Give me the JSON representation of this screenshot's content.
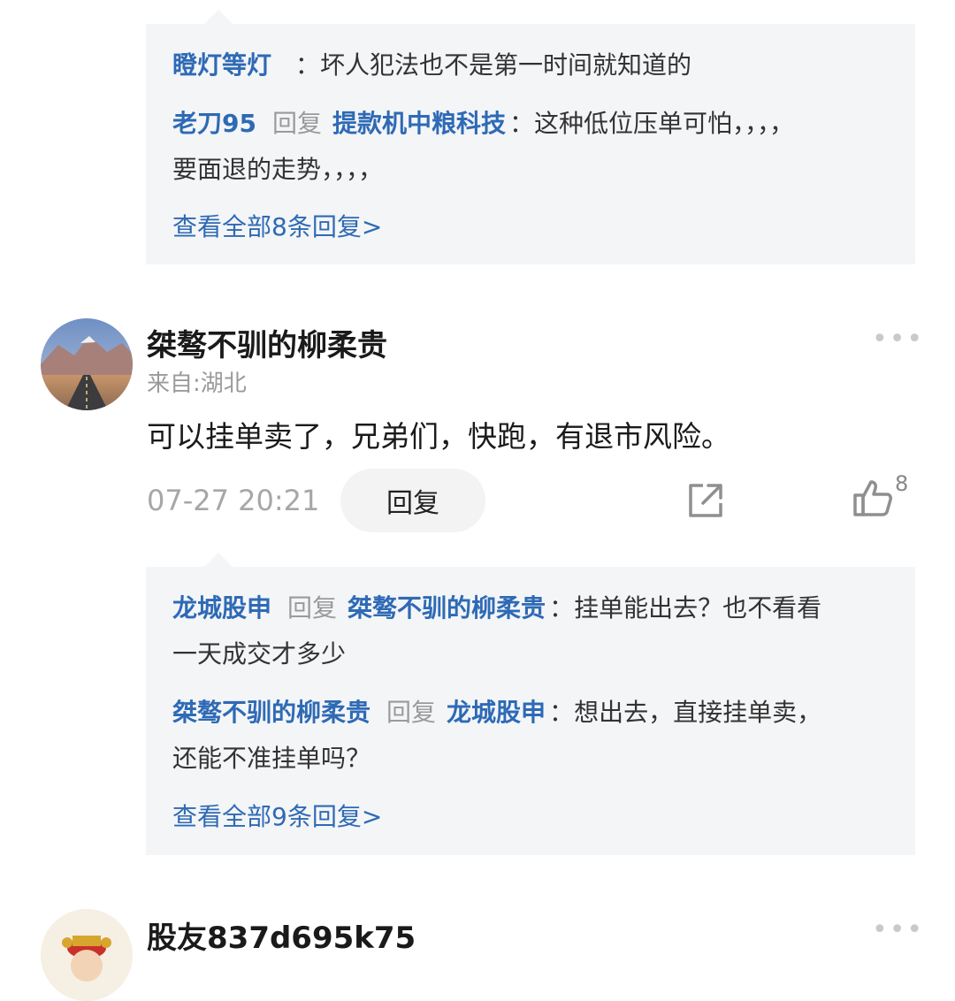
{
  "thread1": {
    "replies": [
      {
        "user": "瞪灯等灯",
        "reply_to": "",
        "text": "坏人犯法也不是第一时间就知道的"
      },
      {
        "user": "老刀95",
        "reply_word": "回复",
        "reply_to": "提款机中粮科技",
        "text_line1": "这种低位压单可怕，，，，",
        "text_line2": "要面退的走势，，，，"
      }
    ],
    "view_all": "查看全部8条回复>"
  },
  "comment1": {
    "author": "桀骜不驯的柳柔贵",
    "location": "来自:湖北",
    "text": "可以挂单卖了，兄弟们，快跑，有退市风险。",
    "timestamp": "07-27 20:21",
    "reply_label": "回复",
    "likes": "8",
    "more_icon": "more-dots-icon",
    "share_icon": "share-icon",
    "like_icon": "thumbs-up-icon"
  },
  "thread2": {
    "replies": [
      {
        "user": "龙城股申",
        "reply_word": "回复",
        "reply_to": "桀骜不驯的柳柔贵",
        "text_line1": "挂单能出去？也不看看",
        "text_line2": "一天成交才多少"
      },
      {
        "user": "桀骜不驯的柳柔贵",
        "reply_word": "回复",
        "reply_to": "龙城股申",
        "text_line1": "想出去，直接挂单卖，",
        "text_line2": "还能不准挂单吗？"
      }
    ],
    "view_all": "查看全部9条回复>"
  },
  "comment2": {
    "author": "股友837d695k75"
  },
  "colors": {
    "link": "#2e6ab5",
    "panel": "#f4f5f7",
    "muted": "#9a9a9a"
  }
}
